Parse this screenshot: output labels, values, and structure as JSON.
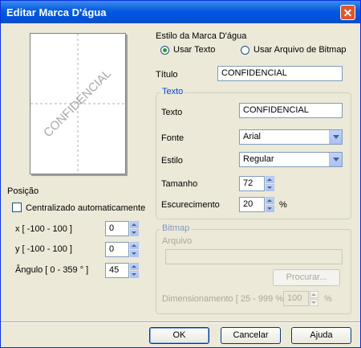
{
  "window": {
    "title": "Editar Marca D'água",
    "close_symbol": "✕"
  },
  "preview": {
    "watermark_text": "CONFIDENCIAL",
    "watermark_color": "#a8a8a8"
  },
  "posicao": {
    "label": "Posição",
    "auto_center_label": "Centralizado automaticamente",
    "auto_center_checked": false,
    "x_label": "x [ -100 - 100 ]",
    "x_value": "0",
    "y_label": "y [ -100 - 100 ]",
    "y_value": "0",
    "angle_label": "Ângulo [ 0 - 359 ° ]",
    "angle_value": "45"
  },
  "estilo": {
    "label": "Estilo da Marca D'água",
    "option_text": "Usar Texto",
    "option_text_selected": true,
    "option_bitmap": "Usar Arquivo de Bitmap",
    "option_bitmap_selected": false
  },
  "titulo": {
    "label": "Título",
    "value": "CONFIDENCIAL"
  },
  "texto_group": {
    "title": "Texto",
    "texto_label": "Texto",
    "texto_value": "CONFIDENCIAL",
    "fonte_label": "Fonte",
    "fonte_value": "Arial",
    "estilo_label": "Estilo",
    "estilo_value": "Regular",
    "tamanho_label": "Tamanho",
    "tamanho_value": "72",
    "escurecimento_label": "Escurecimento",
    "escurecimento_value": "20",
    "percent": "%"
  },
  "bitmap_group": {
    "title": "Bitmap",
    "arquivo_label": "Arquivo",
    "arquivo_value": "",
    "procurar_label": "Procurar...",
    "dimensionamento_label": "Dimensionamento [ 25 - 999 % ]",
    "dimensionamento_value": "100",
    "percent": "%"
  },
  "footer": {
    "ok_label": "OK",
    "cancel_label": "Cancelar",
    "help_label": "Ajuda"
  },
  "colors": {
    "titlebar": "#0054e3",
    "dialog_bg": "#ece9d8",
    "group_title": "#0046d5",
    "radio_dot": "#21a121",
    "close_button": "#e2552b"
  }
}
